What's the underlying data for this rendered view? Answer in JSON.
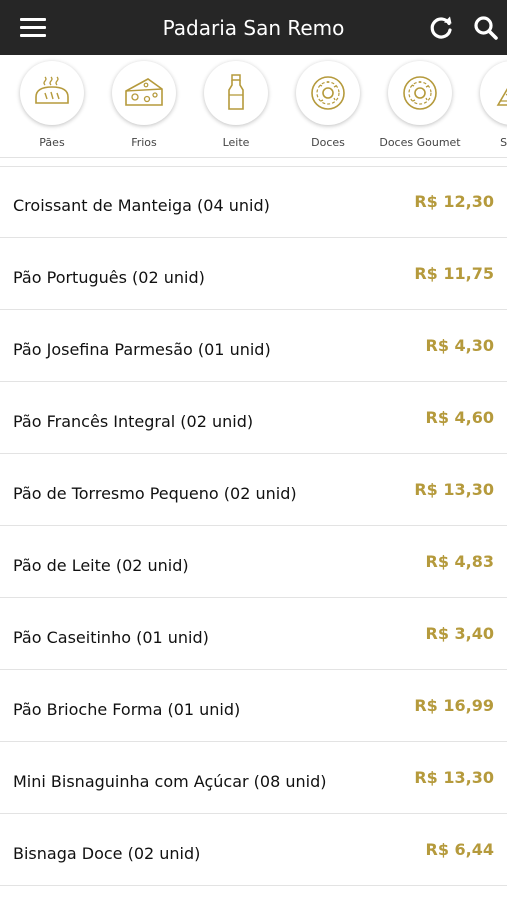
{
  "header": {
    "title": "Padaria San Remo",
    "menu_icon": "hamburger-menu-icon",
    "refresh_icon": "refresh-icon",
    "search_icon": "search-icon",
    "background_color": "#262626"
  },
  "categories": [
    {
      "label": "Pães",
      "icon": "bread-icon"
    },
    {
      "label": "Frios",
      "icon": "cheese-icon"
    },
    {
      "label": "Leite",
      "icon": "milk-bottle-icon"
    },
    {
      "label": "Doces",
      "icon": "donut-icon"
    },
    {
      "label": "Doces Goumet",
      "icon": "donut-icon"
    },
    {
      "label": "Salg",
      "icon": "savory-icon"
    }
  ],
  "accent_color": "#b59a3c",
  "products": [
    {
      "name": "Croissant de Manteiga (04 unid)",
      "price": "R$ 12,30"
    },
    {
      "name": "Pão Português (02 unid)",
      "price": "R$ 11,75"
    },
    {
      "name": "Pão Josefina Parmesão (01 unid)",
      "price": "R$ 4,30"
    },
    {
      "name": "Pão Francês Integral (02 unid)",
      "price": "R$ 4,60"
    },
    {
      "name": "Pão de Torresmo Pequeno (02 unid)",
      "price": "R$ 13,30"
    },
    {
      "name": "Pão de Leite (02 unid)",
      "price": "R$ 4,83"
    },
    {
      "name": "Pão Caseitinho (01 unid)",
      "price": "R$ 3,40"
    },
    {
      "name": "Pão Brioche Forma (01 unid)",
      "price": "R$ 16,99"
    },
    {
      "name": "Mini Bisnaguinha com Açúcar (08 unid)",
      "price": "R$ 13,30"
    },
    {
      "name": "Bisnaga Doce (02 unid)",
      "price": "R$ 6,44"
    }
  ]
}
